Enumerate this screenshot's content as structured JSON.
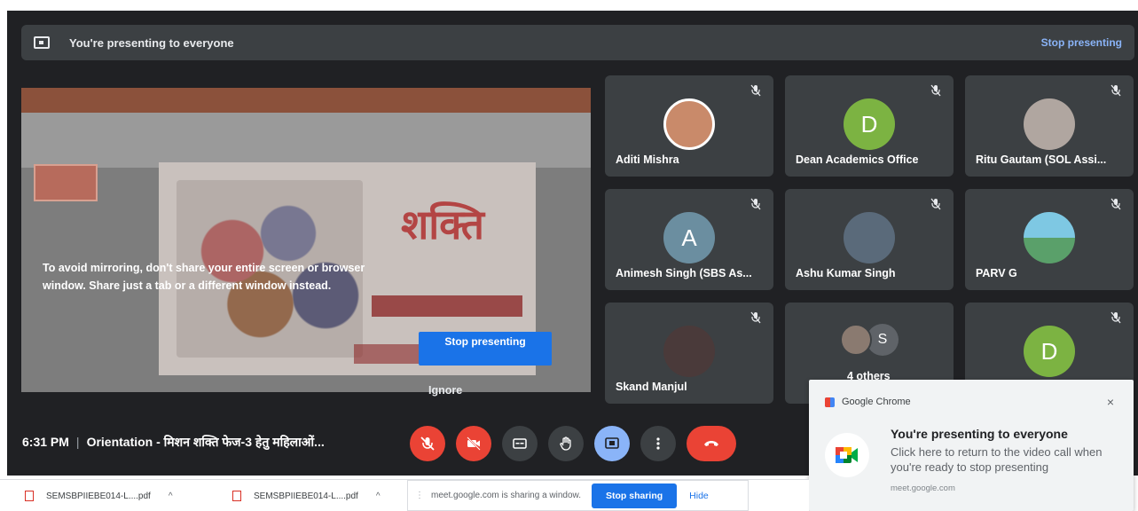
{
  "presenting_bar": {
    "message": "You're presenting to everyone",
    "stop_link": "Stop presenting"
  },
  "stage": {
    "slide_logo_text": "शक्ति",
    "warning": "To avoid mirroring, don't share your entire screen or browser window. Share just a tab or a different window instead.",
    "stop_presenting_button": "Stop presenting",
    "ignore_button": "Ignore"
  },
  "participants": [
    {
      "name": "Aditi Mishra",
      "initial": "",
      "avatar_color": "#c98a6a"
    },
    {
      "name": "Dean Academics Office",
      "initial": "D",
      "avatar_color": "#7cb342"
    },
    {
      "name": "Ritu Gautam (SOL Assi...",
      "initial": "",
      "avatar_color": "#b0a6a0"
    },
    {
      "name": "Animesh Singh (SBS As...",
      "initial": "A",
      "avatar_color": "#6b8ea0"
    },
    {
      "name": "Ashu Kumar Singh",
      "initial": "",
      "avatar_color": "#5a6a7a"
    },
    {
      "name": "PARV G",
      "initial": "",
      "avatar_color": "#56a0b8"
    },
    {
      "name": "Skand Manjul",
      "initial": "",
      "avatar_color": "#4a3a3a"
    },
    {
      "name": "4 others",
      "initial": "S",
      "avatar_color": "#5f6368"
    },
    {
      "name": "",
      "initial": "D",
      "avatar_color": "#7cb342"
    }
  ],
  "bottom_bar": {
    "time": "6:31 PM",
    "separator": "|",
    "meeting_title": "Orientation - मिशन शक्ति फेज-3 हेतु महिलाओं..."
  },
  "colors": {
    "danger": "#ea4335",
    "presenting_active": "#8ab4f8",
    "control_bg": "#3c4043"
  },
  "notification": {
    "app": "Google Chrome",
    "close": "×",
    "title": "You're presenting to everyone",
    "body": "Click here to return to the video call when you're ready to stop presenting",
    "origin": "meet.google.com"
  },
  "downloads": [
    {
      "file": "SEMSBPIIEBE014-L....pdf",
      "caret": "^"
    },
    {
      "file": "SEMSBPIIEBE014-L....pdf",
      "caret": "^"
    }
  ],
  "share_bar": {
    "message": "meet.google.com is sharing a window.",
    "stop_sharing": "Stop sharing",
    "hide": "Hide"
  }
}
